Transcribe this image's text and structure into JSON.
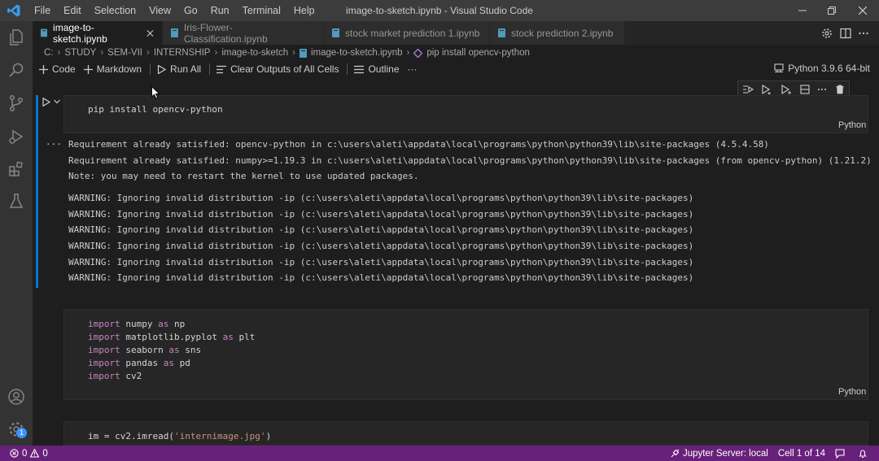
{
  "window": {
    "title": "image-to-sketch.ipynb - Visual Studio Code",
    "menu": [
      "File",
      "Edit",
      "Selection",
      "View",
      "Go",
      "Run",
      "Terminal",
      "Help"
    ]
  },
  "tabs": [
    {
      "label": "image-to-sketch.ipynb",
      "active": true
    },
    {
      "label": "Iris-Flower-Classification.ipynb",
      "active": false
    },
    {
      "label": "stock market prediction 1.ipynb",
      "active": false
    },
    {
      "label": "stock prediction 2.ipynb",
      "active": false
    }
  ],
  "breadcrumb": [
    "C:",
    "STUDY",
    "SEM-VII",
    "INTERNSHIP",
    "image-to-sketch",
    "image-to-sketch.ipynb",
    "pip install opencv-python"
  ],
  "toolbar": {
    "code": "Code",
    "markdown": "Markdown",
    "run_all": "Run All",
    "clear_outputs": "Clear Outputs of All Cells",
    "outline": "Outline",
    "more": "···"
  },
  "kernel": "Python 3.9.6 64-bit",
  "cells": [
    {
      "code": "pip install opencv-python",
      "language": "Python",
      "output_more": "···",
      "outputs": [
        "Requirement already satisfied: opencv-python in c:\\users\\aleti\\appdata\\local\\programs\\python\\python39\\lib\\site-packages (4.5.4.58)",
        "Requirement already satisfied: numpy>=1.19.3 in c:\\users\\aleti\\appdata\\local\\programs\\python\\python39\\lib\\site-packages (from opencv-python) (1.21.2)",
        "Note: you may need to restart the kernel to use updated packages.",
        "WARNING: Ignoring invalid distribution -ip (c:\\users\\aleti\\appdata\\local\\programs\\python\\python39\\lib\\site-packages)",
        "WARNING: Ignoring invalid distribution -ip (c:\\users\\aleti\\appdata\\local\\programs\\python\\python39\\lib\\site-packages)",
        "WARNING: Ignoring invalid distribution -ip (c:\\users\\aleti\\appdata\\local\\programs\\python\\python39\\lib\\site-packages)",
        "WARNING: Ignoring invalid distribution -ip (c:\\users\\aleti\\appdata\\local\\programs\\python\\python39\\lib\\site-packages)",
        "WARNING: Ignoring invalid distribution -ip (c:\\users\\aleti\\appdata\\local\\programs\\python\\python39\\lib\\site-packages)",
        "WARNING: Ignoring invalid distribution -ip (c:\\users\\aleti\\appdata\\local\\programs\\python\\python39\\lib\\site-packages)"
      ]
    },
    {
      "language": "Python",
      "lines": [
        {
          "kw": "import",
          "mod": "numpy",
          "as": "as",
          "alias": "np"
        },
        {
          "kw": "import",
          "mod": "matplotlib.pyplot",
          "as": "as",
          "alias": "plt"
        },
        {
          "kw": "import",
          "mod": "seaborn",
          "as": "as",
          "alias": "sns"
        },
        {
          "kw": "import",
          "mod": "pandas",
          "as": "as",
          "alias": "pd"
        },
        {
          "kw": "import",
          "mod": "cv2",
          "as": "",
          "alias": ""
        }
      ]
    },
    {
      "pre": "im = cv2.imread(",
      "str": "'internimage.jpg'",
      "post": ")"
    }
  ],
  "status": {
    "errors": "0",
    "warnings": "0",
    "jupyter": "Jupyter Server: local",
    "cell": "Cell 1 of 14",
    "settings_badge": "1"
  },
  "colors": {
    "statusbar": "#68217a",
    "focus": "#007acc",
    "keyword": "#c586c0",
    "string": "#ce9178"
  }
}
